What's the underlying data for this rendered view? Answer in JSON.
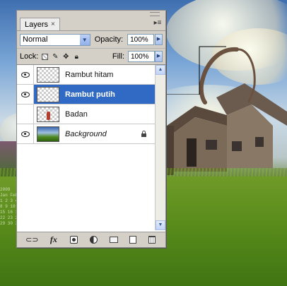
{
  "panel": {
    "tab_label": "Layers",
    "tab_close": "×",
    "menu_icon": "panel-menu-icon"
  },
  "options": {
    "blend_mode": "Normal",
    "opacity_label": "Opacity:",
    "opacity_value": "100%",
    "lock_label": "Lock:",
    "fill_label": "Fill:",
    "fill_value": "100%"
  },
  "layers": [
    {
      "name": "Rambut hitam",
      "visible": true,
      "selected": false,
      "thumb": "transparent"
    },
    {
      "name": "Rambut putih",
      "visible": true,
      "selected": true,
      "thumb": "transparent"
    },
    {
      "name": "Badan",
      "visible": false,
      "selected": false,
      "thumb": "figure"
    },
    {
      "name": "Background",
      "visible": true,
      "selected": false,
      "thumb": "scene",
      "locked": true
    }
  ],
  "bottom_icons": [
    "link-icon",
    "fx-icon",
    "mask-icon",
    "adjustment-icon",
    "folder-icon",
    "new-layer-icon",
    "trash-icon"
  ],
  "fx_glyph": "fx",
  "calendar_text": "2009\nJan Feb Mar\n1 2 3 4 5 6 7\n8 9 10 11 12\n15 16 17 18\n22 23 24 25\n29 30 31"
}
